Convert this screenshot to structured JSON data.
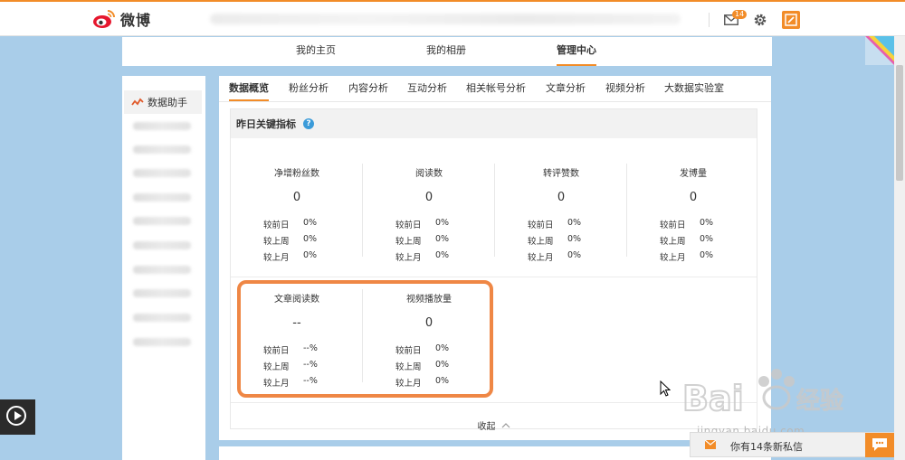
{
  "app": {
    "logo_text": "微博"
  },
  "header": {
    "mail_badge": "14"
  },
  "nav": {
    "items": [
      "我的主页",
      "我的相册",
      "管理中心"
    ],
    "active": "管理中心"
  },
  "sidebar": {
    "heading": "数据助手"
  },
  "tabs": [
    "数据概览",
    "粉丝分析",
    "内容分析",
    "互动分析",
    "相关帐号分析",
    "文章分析",
    "视频分析",
    "大数据实验室"
  ],
  "section": {
    "title": "昨日关键指标",
    "help": "?"
  },
  "compare_labels": [
    "较前日",
    "较上周",
    "较上月"
  ],
  "metrics": [
    {
      "name": "净增粉丝数",
      "value": "0",
      "changes": [
        "0%",
        "0%",
        "0%"
      ]
    },
    {
      "name": "阅读数",
      "value": "0",
      "changes": [
        "0%",
        "0%",
        "0%"
      ]
    },
    {
      "name": "转评赞数",
      "value": "0",
      "changes": [
        "0%",
        "0%",
        "0%"
      ]
    },
    {
      "name": "发博量",
      "value": "0",
      "changes": [
        "0%",
        "0%",
        "0%"
      ]
    },
    {
      "name": "文章阅读数",
      "value": "--",
      "changes": [
        "--%",
        "--%",
        "--%"
      ]
    },
    {
      "name": "视频播放量",
      "value": "0",
      "changes": [
        "0%",
        "0%",
        "0%"
      ]
    }
  ],
  "collapse_label": "收起",
  "watermark": {
    "text": "jingyan.baidu.com"
  },
  "pm_bar": {
    "text": "你有14条新私信"
  },
  "colors": {
    "accent": "#f28c28",
    "highlight": "#ef8745",
    "background": "#a9cde9",
    "help": "#3b9bd9"
  }
}
